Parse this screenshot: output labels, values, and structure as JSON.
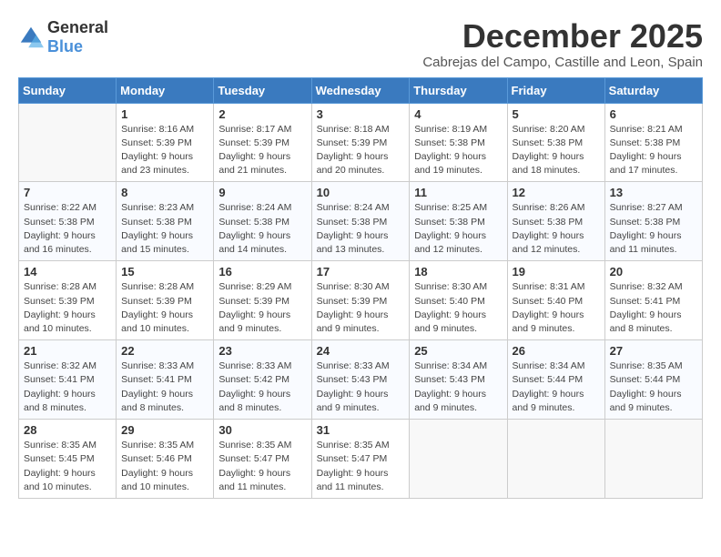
{
  "header": {
    "logo_general": "General",
    "logo_blue": "Blue",
    "month_title": "December 2025",
    "location": "Cabrejas del Campo, Castille and Leon, Spain"
  },
  "weekdays": [
    "Sunday",
    "Monday",
    "Tuesday",
    "Wednesday",
    "Thursday",
    "Friday",
    "Saturday"
  ],
  "weeks": [
    [
      {
        "day": "",
        "info": ""
      },
      {
        "day": "1",
        "info": "Sunrise: 8:16 AM\nSunset: 5:39 PM\nDaylight: 9 hours\nand 23 minutes."
      },
      {
        "day": "2",
        "info": "Sunrise: 8:17 AM\nSunset: 5:39 PM\nDaylight: 9 hours\nand 21 minutes."
      },
      {
        "day": "3",
        "info": "Sunrise: 8:18 AM\nSunset: 5:39 PM\nDaylight: 9 hours\nand 20 minutes."
      },
      {
        "day": "4",
        "info": "Sunrise: 8:19 AM\nSunset: 5:38 PM\nDaylight: 9 hours\nand 19 minutes."
      },
      {
        "day": "5",
        "info": "Sunrise: 8:20 AM\nSunset: 5:38 PM\nDaylight: 9 hours\nand 18 minutes."
      },
      {
        "day": "6",
        "info": "Sunrise: 8:21 AM\nSunset: 5:38 PM\nDaylight: 9 hours\nand 17 minutes."
      }
    ],
    [
      {
        "day": "7",
        "info": "Sunrise: 8:22 AM\nSunset: 5:38 PM\nDaylight: 9 hours\nand 16 minutes."
      },
      {
        "day": "8",
        "info": "Sunrise: 8:23 AM\nSunset: 5:38 PM\nDaylight: 9 hours\nand 15 minutes."
      },
      {
        "day": "9",
        "info": "Sunrise: 8:24 AM\nSunset: 5:38 PM\nDaylight: 9 hours\nand 14 minutes."
      },
      {
        "day": "10",
        "info": "Sunrise: 8:24 AM\nSunset: 5:38 PM\nDaylight: 9 hours\nand 13 minutes."
      },
      {
        "day": "11",
        "info": "Sunrise: 8:25 AM\nSunset: 5:38 PM\nDaylight: 9 hours\nand 12 minutes."
      },
      {
        "day": "12",
        "info": "Sunrise: 8:26 AM\nSunset: 5:38 PM\nDaylight: 9 hours\nand 12 minutes."
      },
      {
        "day": "13",
        "info": "Sunrise: 8:27 AM\nSunset: 5:38 PM\nDaylight: 9 hours\nand 11 minutes."
      }
    ],
    [
      {
        "day": "14",
        "info": "Sunrise: 8:28 AM\nSunset: 5:39 PM\nDaylight: 9 hours\nand 10 minutes."
      },
      {
        "day": "15",
        "info": "Sunrise: 8:28 AM\nSunset: 5:39 PM\nDaylight: 9 hours\nand 10 minutes."
      },
      {
        "day": "16",
        "info": "Sunrise: 8:29 AM\nSunset: 5:39 PM\nDaylight: 9 hours\nand 9 minutes."
      },
      {
        "day": "17",
        "info": "Sunrise: 8:30 AM\nSunset: 5:39 PM\nDaylight: 9 hours\nand 9 minutes."
      },
      {
        "day": "18",
        "info": "Sunrise: 8:30 AM\nSunset: 5:40 PM\nDaylight: 9 hours\nand 9 minutes."
      },
      {
        "day": "19",
        "info": "Sunrise: 8:31 AM\nSunset: 5:40 PM\nDaylight: 9 hours\nand 9 minutes."
      },
      {
        "day": "20",
        "info": "Sunrise: 8:32 AM\nSunset: 5:41 PM\nDaylight: 9 hours\nand 8 minutes."
      }
    ],
    [
      {
        "day": "21",
        "info": "Sunrise: 8:32 AM\nSunset: 5:41 PM\nDaylight: 9 hours\nand 8 minutes."
      },
      {
        "day": "22",
        "info": "Sunrise: 8:33 AM\nSunset: 5:41 PM\nDaylight: 9 hours\nand 8 minutes."
      },
      {
        "day": "23",
        "info": "Sunrise: 8:33 AM\nSunset: 5:42 PM\nDaylight: 9 hours\nand 8 minutes."
      },
      {
        "day": "24",
        "info": "Sunrise: 8:33 AM\nSunset: 5:43 PM\nDaylight: 9 hours\nand 9 minutes."
      },
      {
        "day": "25",
        "info": "Sunrise: 8:34 AM\nSunset: 5:43 PM\nDaylight: 9 hours\nand 9 minutes."
      },
      {
        "day": "26",
        "info": "Sunrise: 8:34 AM\nSunset: 5:44 PM\nDaylight: 9 hours\nand 9 minutes."
      },
      {
        "day": "27",
        "info": "Sunrise: 8:35 AM\nSunset: 5:44 PM\nDaylight: 9 hours\nand 9 minutes."
      }
    ],
    [
      {
        "day": "28",
        "info": "Sunrise: 8:35 AM\nSunset: 5:45 PM\nDaylight: 9 hours\nand 10 minutes."
      },
      {
        "day": "29",
        "info": "Sunrise: 8:35 AM\nSunset: 5:46 PM\nDaylight: 9 hours\nand 10 minutes."
      },
      {
        "day": "30",
        "info": "Sunrise: 8:35 AM\nSunset: 5:47 PM\nDaylight: 9 hours\nand 11 minutes."
      },
      {
        "day": "31",
        "info": "Sunrise: 8:35 AM\nSunset: 5:47 PM\nDaylight: 9 hours\nand 11 minutes."
      },
      {
        "day": "",
        "info": ""
      },
      {
        "day": "",
        "info": ""
      },
      {
        "day": "",
        "info": ""
      }
    ]
  ]
}
